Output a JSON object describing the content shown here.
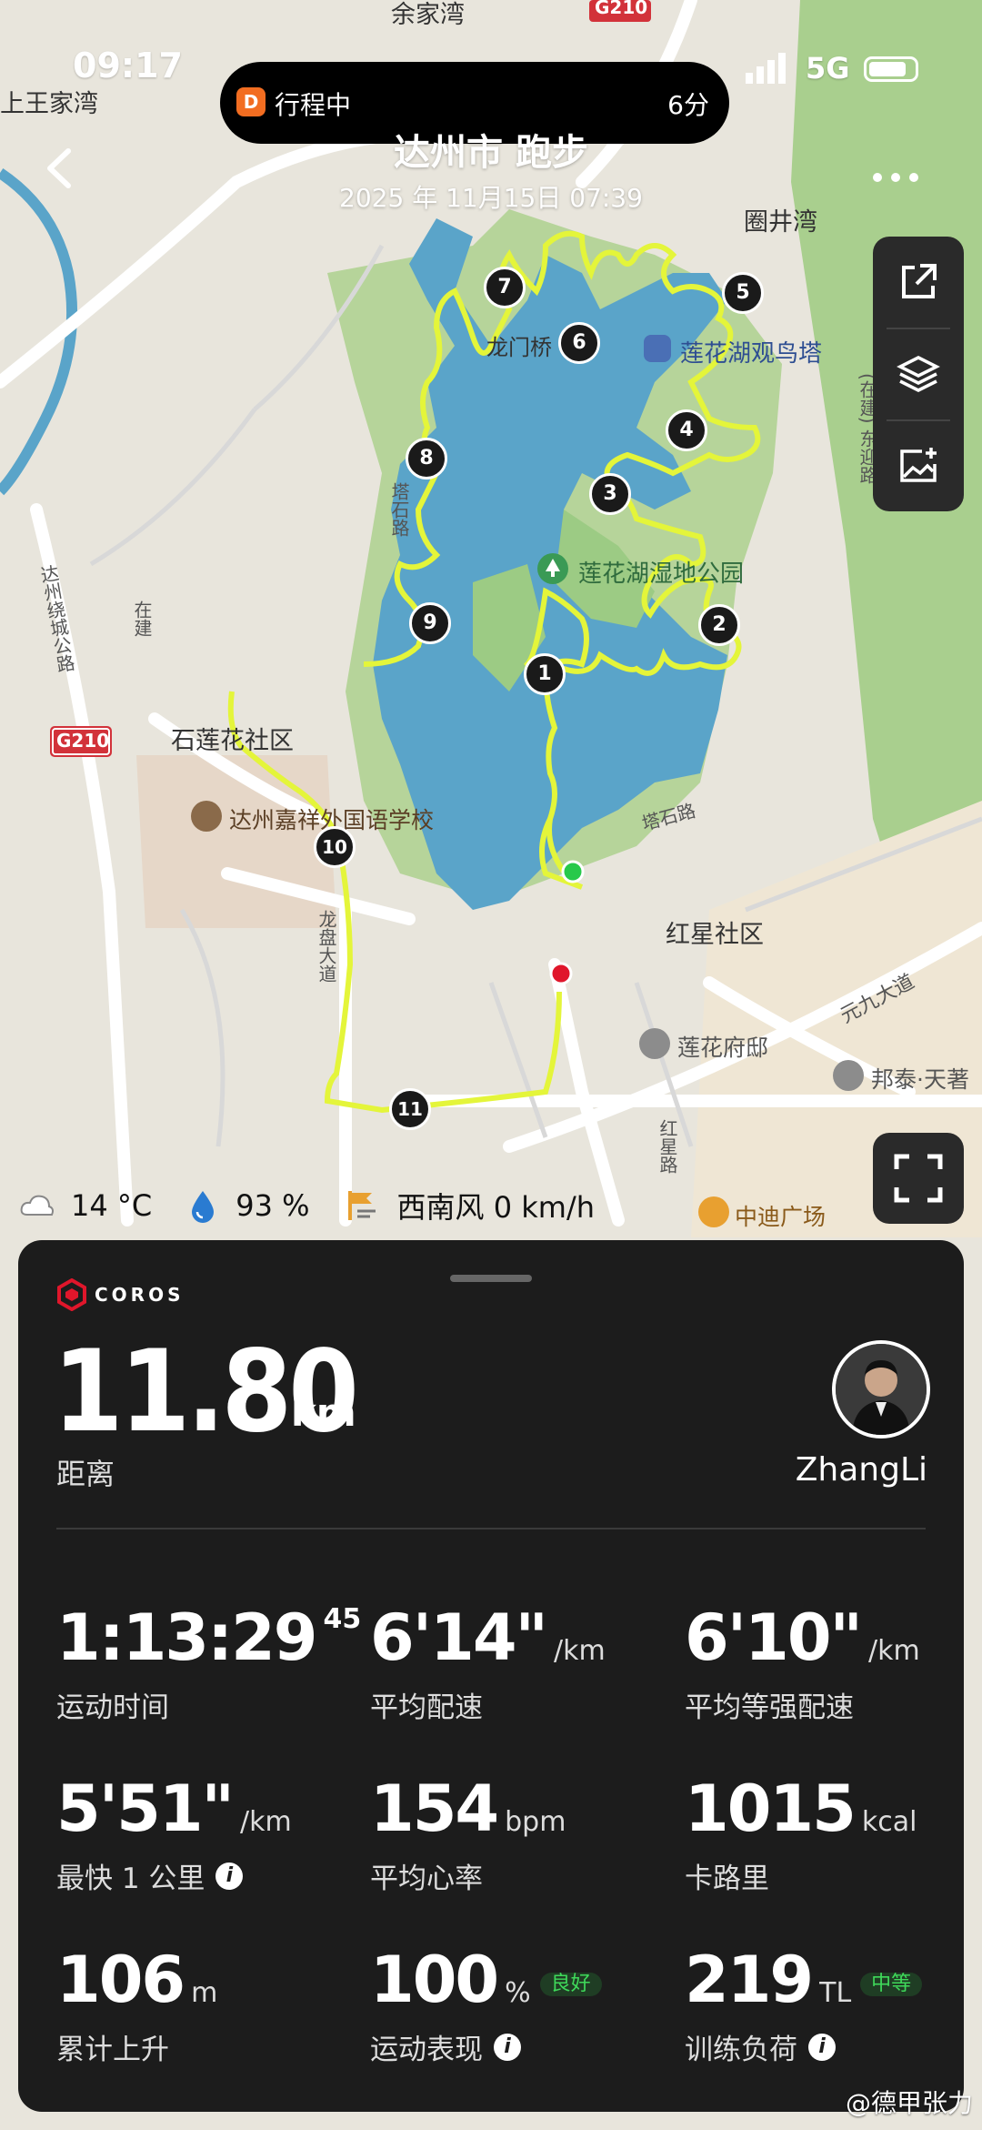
{
  "status_bar": {
    "time": "09:17",
    "island_app_label": "行程中",
    "island_time": "6分",
    "network": "5G"
  },
  "header": {
    "title": "达州市 跑步",
    "subtitle": "2025 年 11月15日 07:39"
  },
  "map": {
    "labels": {
      "yujiawan": "余家湾",
      "g210_top": "G210",
      "shangwangjiawan": "上王家湾",
      "quanjingwan": "圈井湾",
      "longmen": "龙门桥",
      "guanniaota": "莲花湖观鸟塔",
      "wetland": "莲花湖湿地公园",
      "zaijian_road": "(在建) 东迎路",
      "dazhou_ring": "达州绕城公路",
      "zai": "在建",
      "tashi_road1": "塔石路",
      "shilianhua": "石莲花社区",
      "g210_left": "G210",
      "jiaxiang_school": "达州嘉祥外国语学校",
      "tashi_road2": "塔石路",
      "hongxing": "红星社区",
      "yuanjiu": "元九大道",
      "lianhuafudi": "莲花府邸",
      "bangtai": "邦泰·天著",
      "hongxing_road": "红星路",
      "zhongdi": "中迪广场",
      "longpan": "龙盘大道"
    },
    "laps": [
      "1",
      "2",
      "3",
      "4",
      "5",
      "6",
      "7",
      "8",
      "9",
      "10",
      "11"
    ]
  },
  "weather": {
    "temperature": "14 °C",
    "humidity": "93 %",
    "wind": "西南风 0 km/h"
  },
  "panel": {
    "brand": "COROS",
    "distance_value": "11.80",
    "distance_unit": "km",
    "distance_label": "距离",
    "username": "ZhangLi",
    "stats": [
      {
        "value": "1:13:29",
        "sup": "45",
        "unit": "",
        "label": "运动时间"
      },
      {
        "value": "6'14\"",
        "unit": "/km",
        "label": "平均配速"
      },
      {
        "value": "6'10\"",
        "unit": "/km",
        "label": "平均等强配速"
      },
      {
        "value": "5'51\"",
        "unit": "/km",
        "label": "最快 1 公里"
      },
      {
        "value": "154",
        "unit": "bpm",
        "label": "平均心率"
      },
      {
        "value": "1015",
        "unit": "kcal",
        "label": "卡路里"
      },
      {
        "value": "106",
        "unit": "m",
        "label": "累计上升"
      },
      {
        "value": "100",
        "unit": "%",
        "badge": "良好",
        "label": "运动表现"
      },
      {
        "value": "219",
        "unit": "TL",
        "badge": "中等",
        "label": "训练负荷"
      }
    ]
  },
  "watermark": "@德甲张力",
  "colors": {
    "route": "#e4f53a",
    "lake": "#5aa4c9",
    "park": "#a8d08a",
    "panel": "#1c1c1c",
    "good_badge": "#3fd95a"
  }
}
